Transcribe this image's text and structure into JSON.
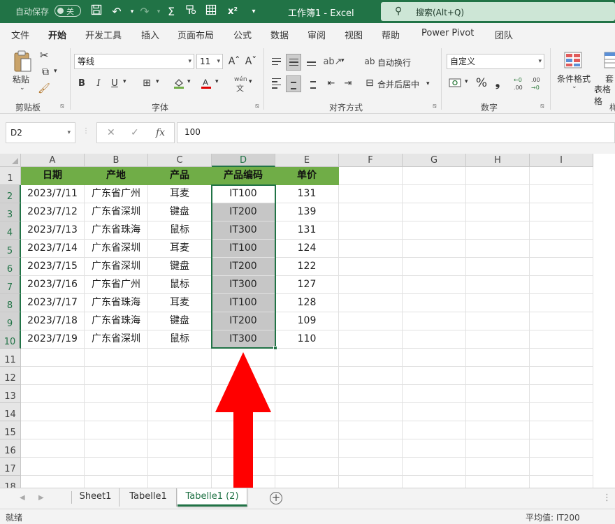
{
  "titlebar": {
    "autosave_label": "自动保存",
    "autosave_state": "关",
    "doc_title": "工作簿1 - Excel",
    "search_placeholder": "搜索(Alt+Q)"
  },
  "menu": {
    "tabs": [
      "文件",
      "开始",
      "开发工具",
      "插入",
      "页面布局",
      "公式",
      "数据",
      "审阅",
      "视图",
      "帮助",
      "Power Pivot",
      "团队"
    ],
    "active": "开始"
  },
  "ribbon": {
    "clipboard": {
      "paste_label": "粘贴",
      "group_label": "剪贴板"
    },
    "font": {
      "font_name": "等线",
      "font_size": "11",
      "grow_label": "A^",
      "shrink_label": "Aˇ",
      "bold": "B",
      "italic": "I",
      "underline": "U",
      "phonetic_label": "wén",
      "group_label": "字体"
    },
    "alignment": {
      "wrap_text_label": "自动换行",
      "merge_center_label": "合并后居中",
      "group_label": "对齐方式"
    },
    "number": {
      "format_value": "自定义",
      "percent_label": "%",
      "comma_label": "❟",
      "group_label": "数字"
    },
    "styles": {
      "conditional_format_label": "条件格式",
      "table_format_label_1": "套",
      "table_format_label_2": "表格格",
      "group_label_partial": "样"
    }
  },
  "formula_bar": {
    "name_box": "D2",
    "fx_label": "fx",
    "value": "100"
  },
  "grid": {
    "columns": [
      "A",
      "B",
      "C",
      "D",
      "E",
      "F",
      "G",
      "H",
      "I"
    ],
    "rows": [
      "1",
      "2",
      "3",
      "4",
      "5",
      "6",
      "7",
      "8",
      "9",
      "10",
      "11",
      "12",
      "13",
      "14",
      "15",
      "16",
      "17",
      "18"
    ],
    "selected_column": "D",
    "table_headers": [
      "日期",
      "产地",
      "产品",
      "产品编码",
      "单价"
    ],
    "table_rows": [
      [
        "2023/7/11",
        "广东省广州",
        "耳麦",
        "IT100",
        "131"
      ],
      [
        "2023/7/12",
        "广东省深圳",
        "键盘",
        "IT200",
        "139"
      ],
      [
        "2023/7/13",
        "广东省珠海",
        "鼠标",
        "IT300",
        "131"
      ],
      [
        "2023/7/14",
        "广东省深圳",
        "耳麦",
        "IT100",
        "124"
      ],
      [
        "2023/7/15",
        "广东省深圳",
        "键盘",
        "IT200",
        "122"
      ],
      [
        "2023/7/16",
        "广东省广州",
        "鼠标",
        "IT300",
        "127"
      ],
      [
        "2023/7/17",
        "广东省珠海",
        "耳麦",
        "IT100",
        "128"
      ],
      [
        "2023/7/18",
        "广东省珠海",
        "键盘",
        "IT200",
        "109"
      ],
      [
        "2023/7/19",
        "广东省深圳",
        "鼠标",
        "IT300",
        "110"
      ]
    ],
    "header_fill": "#70ad47",
    "selection_color": "#217346"
  },
  "sheets": {
    "tabs": [
      "Sheet1",
      "Tabelle1",
      "Tabelle1 (2)"
    ],
    "active": "Tabelle1 (2)"
  },
  "status": {
    "ready": "就绪",
    "average": "平均值: IT200"
  },
  "annotation": {
    "arrow_color": "#ff0000",
    "arrow_direction": "up"
  }
}
